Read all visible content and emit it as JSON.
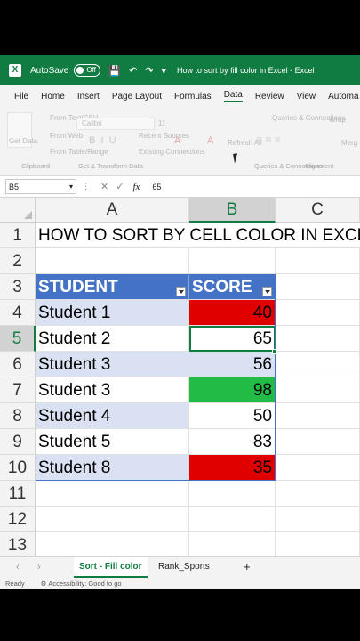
{
  "titlebar": {
    "logo": "X",
    "autosave_label": "AutoSave",
    "autosave_state": "Off",
    "title": "How to sort by fill color in Excel  -  Excel"
  },
  "menu": {
    "tabs": [
      "File",
      "Home",
      "Insert",
      "Page Layout",
      "Formulas",
      "Data",
      "Review",
      "View",
      "Automa"
    ],
    "active_index": 5
  },
  "ribbon": {
    "get_data": "Get Data",
    "from_text": "From Text/CSV",
    "from_web": "From Web",
    "from_table": "From Table/Range",
    "recent_sources": "Recent Sources",
    "existing_connections": "Existing Connections",
    "font_name": "Calibri",
    "font_size": "11",
    "refresh_all": "Refresh All",
    "queries": "Queries & Connections",
    "wrap": "Wrap",
    "merge": "Merg",
    "group_clipboard": "Clipboard",
    "group_transform": "Get & Transform Data",
    "group_queries": "Queries & Connections",
    "group_alignment": "Alignment"
  },
  "formula_bar": {
    "name_box": "B5",
    "value": "65"
  },
  "columns": [
    "A",
    "B",
    "C"
  ],
  "rows": [
    "1",
    "2",
    "3",
    "4",
    "5",
    "6",
    "7",
    "8",
    "9",
    "10",
    "11",
    "12",
    "13"
  ],
  "sheet": {
    "heading": "HOW TO SORT BY CELL COLOR IN EXCEL",
    "header_student": "STUDENT",
    "header_score": "SCORE",
    "records": [
      {
        "student": "Student 1",
        "score": "40",
        "fill": "red"
      },
      {
        "student": "Student 2",
        "score": "65",
        "fill": "white"
      },
      {
        "student": "Student 3",
        "score": "56",
        "fill": "band"
      },
      {
        "student": "Student 3",
        "score": "98",
        "fill": "green"
      },
      {
        "student": "Student 4",
        "score": "50",
        "fill": "white"
      },
      {
        "student": "Student 5",
        "score": "83",
        "fill": "white"
      },
      {
        "student": "Student 8",
        "score": "35",
        "fill": "red"
      }
    ]
  },
  "sheet_tabs": {
    "tabs": [
      "Sort - Fill color",
      "Rank_Sports"
    ],
    "add": "+"
  },
  "status": {
    "ready": "Ready",
    "accessibility": "Accessibility: Good to go"
  },
  "colors": {
    "excel_green": "#107c41",
    "header_blue": "#4472c4",
    "band_blue": "#d9e1f2",
    "red_fill": "#e00000",
    "green_fill": "#22bb45"
  }
}
